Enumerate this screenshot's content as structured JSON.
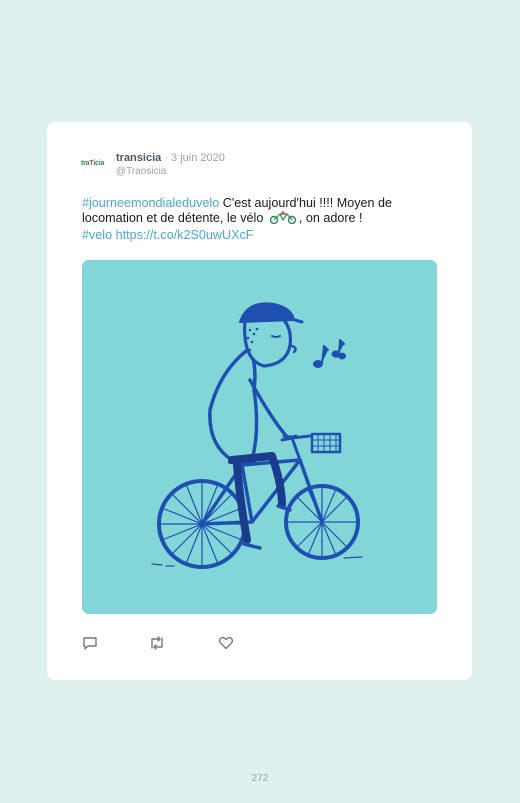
{
  "tweet": {
    "account_logo_text": "traTicia",
    "display_name": "transicia",
    "date": "· 3 juin 2020",
    "handle": "@Transicia",
    "hashtag_1": "#journeemondialeduvelo",
    "text_part_1": " C'est aujourd'hui !!!! Moyen de locomation et de détente, le vélo",
    "text_part_2": ", on adore !",
    "hashtag_2": "#velo",
    "link": "https://t.co/k2S0uwUXcF",
    "media_alt": "Illustration of a man riding a bicycle and whistling musical notes"
  },
  "actions": {
    "reply_icon": "reply-icon",
    "retweet_icon": "retweet-icon",
    "like_icon": "like-icon"
  },
  "page": {
    "number": "272"
  },
  "colors": {
    "background": "#dff1ef",
    "card": "#ffffff",
    "link": "#4aa6e0",
    "illustration_background": "#83d6d8",
    "illustration_ink": "#1f4fb0"
  }
}
